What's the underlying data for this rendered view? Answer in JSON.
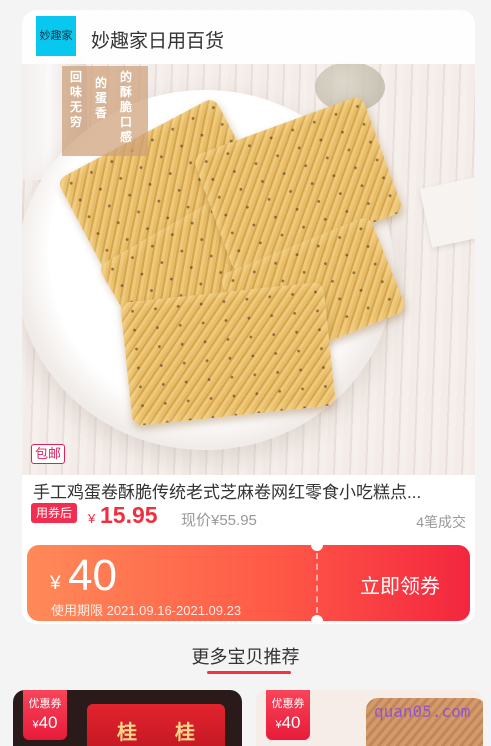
{
  "shop": {
    "logo_text": "妙趣家",
    "name": "妙趣家日用百货"
  },
  "product": {
    "image_banner": [
      "回味无穷",
      "的蛋香",
      "的酥脆口感"
    ],
    "badge": "包邮",
    "title": "手工鸡蛋卷酥脆传统老式芝麻卷网红零食小吃糕点...",
    "coupon_tag": "用券后",
    "currency": "¥",
    "price": "15.95",
    "original_price": "现价¥55.95",
    "sold": "4笔成交"
  },
  "coupon": {
    "currency": "¥",
    "amount": "40",
    "validity": "使用期限 2021.09.16-2021.09.23",
    "button": "立即领券"
  },
  "recommend": {
    "title": "更多宝贝推荐",
    "items": [
      {
        "ticket_label": "优惠券",
        "ticket_currency": "¥",
        "ticket_amount": "40",
        "pack_text": "桂"
      },
      {
        "ticket_label": "优惠券",
        "ticket_currency": "¥",
        "ticket_amount": "40"
      }
    ]
  },
  "watermark": "quan05.com",
  "colors": {
    "accent": "#f0303f",
    "logo_bg": "#08c8ef",
    "coupon_start": "#ff8a58",
    "coupon_end": "#f3263f"
  }
}
